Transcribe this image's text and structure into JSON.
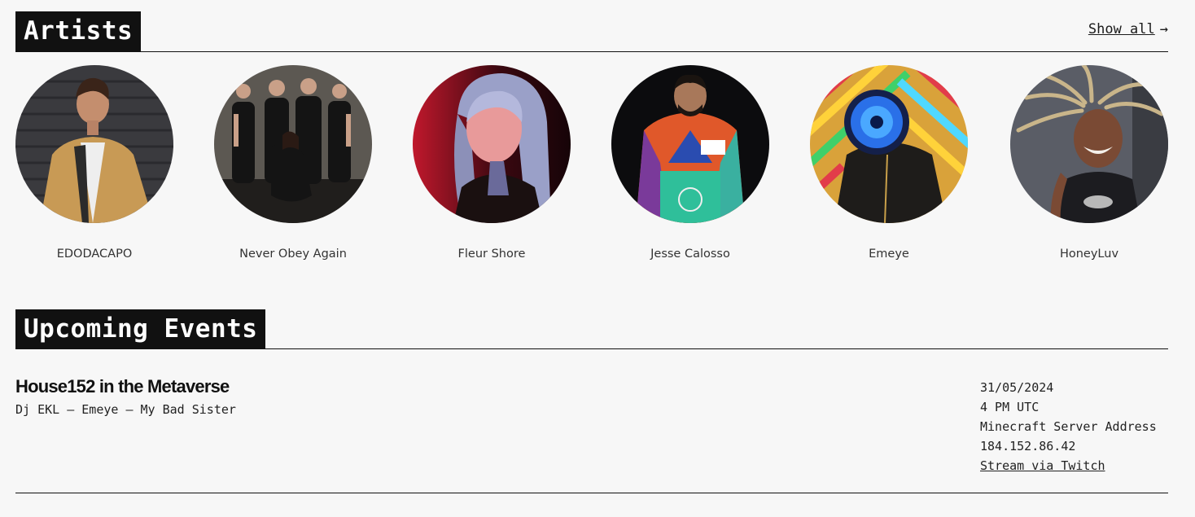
{
  "artists_section": {
    "title": "Artists",
    "show_all_label": "Show all",
    "show_all_arrow": "→",
    "items": [
      {
        "name": "EDODACAPO",
        "photo": "portrait-photo"
      },
      {
        "name": "Never Obey Again",
        "photo": "band-group-photo"
      },
      {
        "name": "Fleur Shore",
        "photo": "portrait-photo"
      },
      {
        "name": "Jesse Calosso",
        "photo": "portrait-photo"
      },
      {
        "name": "Emeye",
        "photo": "led-mask-portrait-photo"
      },
      {
        "name": "HoneyLuv",
        "photo": "portrait-photo"
      }
    ]
  },
  "events_section": {
    "title": "Upcoming Events",
    "events": [
      {
        "title": "House152 in the Metaverse",
        "lineup": "Dj EKL – Emeye – My Bad Sister",
        "date": "31/05/2024",
        "time": "4 PM UTC",
        "location_label": "Minecraft Server Address",
        "address": "184.152.86.42",
        "stream_label": "Stream via Twitch"
      }
    ]
  },
  "colors": {
    "background": "#f7f7f7",
    "heading_bg": "#111111",
    "heading_text": "#ffffff",
    "text": "#1a1a1a"
  }
}
